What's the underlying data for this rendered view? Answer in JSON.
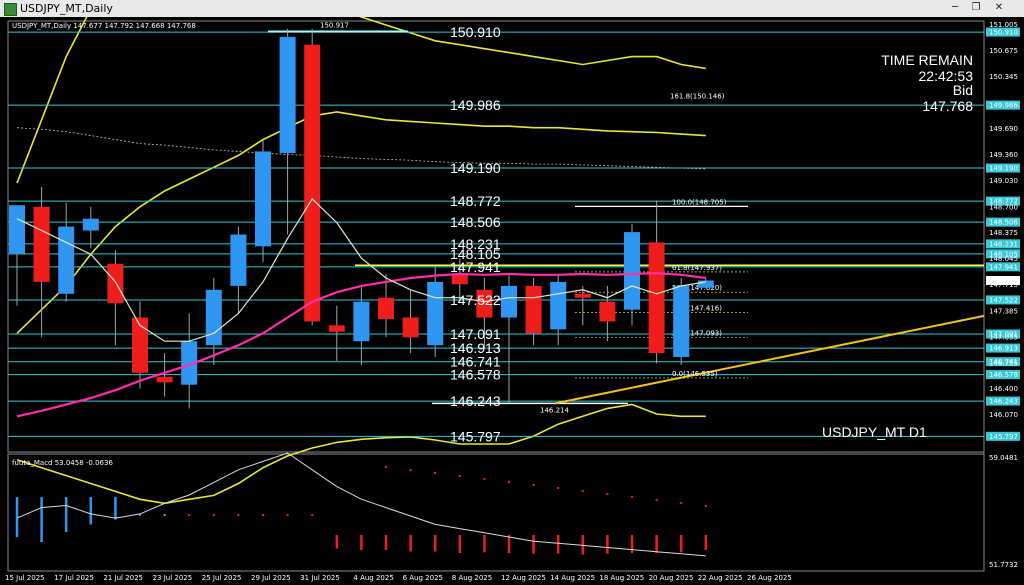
{
  "window": {
    "title": "USDJPY_MT,Daily",
    "min_glyph": "─",
    "max_glyph": "❐",
    "close_glyph": "✕"
  },
  "ohlc_header": "USDJPY_MT,Daily  147.677 147.792 147.668 147.768",
  "info_panel": {
    "label": "TIME REMAIN",
    "time": "22:42:53",
    "bid_label": "Bid",
    "bid": "147.768"
  },
  "watermark": "USDJPY_MT D1",
  "indicator_label": "fuuta_Macd 53.0458  -0.0636",
  "price_axis": [
    "151.005",
    "150.910",
    "150.675",
    "150.345",
    "149.986",
    "149.690",
    "149.360",
    "149.190",
    "149.030",
    "148.772",
    "148.700",
    "148.506",
    "148.375",
    "148.231",
    "148.105",
    "148.045",
    "147.941",
    "147.768",
    "147.715",
    "147.522",
    "147.385",
    "147.091",
    "147.055",
    "146.913",
    "146.741",
    "146.725",
    "146.578",
    "146.400",
    "146.243",
    "146.070",
    "145.797"
  ],
  "sub_axis": [
    "59.0481",
    "51.7732"
  ],
  "level_labels": [
    "150.910",
    "149.986",
    "149.190",
    "148.772",
    "148.506",
    "148.231",
    "148.105",
    "147.941",
    "147.522",
    "147.091",
    "146.913",
    "146.741",
    "146.578",
    "146.243",
    "145.797"
  ],
  "swing_high": "150.917",
  "swing_low": "146.214",
  "fib_labels": [
    "161.8(150.146)",
    "100.0(148.705)",
    "61.8(147.937)",
    "50.0(147.620)",
    "38.2(147.416)",
    "23.6(147.093)",
    "0.0(146.535)"
  ],
  "dates": [
    "15 Jul 2025",
    "17 Jul 2025",
    "21 Jul 2025",
    "23 Jul 2025",
    "25 Jul 2025",
    "29 Jul 2025",
    "31 Jul 2025",
    "4 Aug 2025",
    "6 Aug 2025",
    "8 Aug 2025",
    "12 Aug 2025",
    "14 Aug 2025",
    "18 Aug 2025",
    "20 Aug 2025",
    "22 Aug 2025",
    "26 Aug 2025"
  ],
  "colors": {
    "bull": "#2f96f2",
    "bear": "#f01d1d",
    "level": "#37c8d8",
    "fib": "#ffff33",
    "band": "#e8e832",
    "ma_fast": "#ffffff",
    "ma_mid": "#ff2eaa"
  },
  "chart_data": {
    "type": "candlestick",
    "symbol": "USDJPY_MT",
    "timeframe": "Daily",
    "ylim": [
      145.7,
      151.05
    ],
    "candles": [
      {
        "o": 148.1,
        "h": 148.7,
        "l": 147.45,
        "c": 148.72
      },
      {
        "o": 148.7,
        "h": 148.95,
        "l": 147.05,
        "c": 147.75
      },
      {
        "o": 147.6,
        "h": 148.75,
        "l": 147.5,
        "c": 148.45
      },
      {
        "o": 148.4,
        "h": 148.7,
        "l": 148.18,
        "c": 148.55
      },
      {
        "o": 147.98,
        "h": 148.15,
        "l": 146.95,
        "c": 147.48
      },
      {
        "o": 147.3,
        "h": 147.5,
        "l": 146.4,
        "c": 146.6
      },
      {
        "o": 146.55,
        "h": 146.85,
        "l": 146.3,
        "c": 146.48
      },
      {
        "o": 146.45,
        "h": 147.35,
        "l": 146.15,
        "c": 147.0
      },
      {
        "o": 146.95,
        "h": 147.8,
        "l": 146.7,
        "c": 147.65
      },
      {
        "o": 147.7,
        "h": 148.45,
        "l": 147.35,
        "c": 148.35
      },
      {
        "o": 148.2,
        "h": 149.55,
        "l": 148.0,
        "c": 149.4
      },
      {
        "o": 149.38,
        "h": 150.95,
        "l": 148.35,
        "c": 150.85
      },
      {
        "o": 150.75,
        "h": 150.95,
        "l": 147.2,
        "c": 147.25
      },
      {
        "o": 147.2,
        "h": 147.45,
        "l": 146.75,
        "c": 147.12
      },
      {
        "o": 147.0,
        "h": 147.7,
        "l": 146.7,
        "c": 147.5
      },
      {
        "o": 147.55,
        "h": 147.85,
        "l": 147.05,
        "c": 147.28
      },
      {
        "o": 147.3,
        "h": 147.65,
        "l": 146.85,
        "c": 147.05
      },
      {
        "o": 146.95,
        "h": 147.95,
        "l": 146.8,
        "c": 147.75
      },
      {
        "o": 147.85,
        "h": 148.05,
        "l": 147.5,
        "c": 147.72
      },
      {
        "o": 147.65,
        "h": 147.8,
        "l": 146.9,
        "c": 147.3
      },
      {
        "o": 147.3,
        "h": 147.85,
        "l": 146.214,
        "c": 147.7
      },
      {
        "o": 147.7,
        "h": 147.8,
        "l": 146.95,
        "c": 147.1
      },
      {
        "o": 147.15,
        "h": 147.85,
        "l": 146.95,
        "c": 147.75
      },
      {
        "o": 147.6,
        "h": 147.7,
        "l": 147.2,
        "c": 147.55
      },
      {
        "o": 147.5,
        "h": 147.7,
        "l": 147.0,
        "c": 147.25
      },
      {
        "o": 147.4,
        "h": 148.48,
        "l": 147.2,
        "c": 148.38
      },
      {
        "o": 148.25,
        "h": 148.78,
        "l": 146.72,
        "c": 146.85
      },
      {
        "o": 146.8,
        "h": 147.8,
        "l": 146.7,
        "c": 147.7
      },
      {
        "o": 147.677,
        "h": 147.792,
        "l": 147.668,
        "c": 147.768
      }
    ],
    "levels": [
      150.91,
      149.986,
      149.19,
      148.772,
      148.506,
      148.231,
      148.105,
      147.941,
      147.522,
      147.091,
      146.913,
      146.741,
      146.578,
      146.243,
      145.797
    ],
    "fibonacci": {
      "high": 148.705,
      "low": 146.535,
      "ratios": [
        161.8,
        100.0,
        61.8,
        50.0,
        38.2,
        23.6,
        0.0
      ]
    },
    "ma_fast": [
      148.55,
      148.4,
      148.25,
      148.1,
      147.75,
      147.2,
      147.0,
      147.0,
      147.1,
      147.35,
      147.75,
      148.3,
      148.8,
      148.5,
      148.05,
      147.8,
      147.65,
      147.55,
      147.55,
      147.5,
      147.55,
      147.55,
      147.6,
      147.65,
      147.55,
      147.7,
      147.6,
      147.7,
      147.75
    ],
    "ma_pink": [
      146.05,
      146.12,
      146.2,
      146.28,
      146.38,
      146.5,
      146.6,
      146.7,
      146.82,
      146.95,
      147.1,
      147.3,
      147.5,
      147.62,
      147.7,
      147.75,
      147.8,
      147.83,
      147.85,
      147.84,
      147.85,
      147.84,
      147.84,
      147.85,
      147.84,
      147.85,
      147.86,
      147.84,
      147.8
    ],
    "band_upper": [
      149.0,
      149.8,
      150.6,
      151.2,
      151.5,
      151.7,
      151.8,
      151.8,
      151.7,
      151.6,
      151.5,
      151.4,
      151.3,
      151.2,
      151.1,
      151.0,
      150.9,
      150.8,
      150.75,
      150.7,
      150.65,
      150.6,
      150.55,
      150.5,
      150.55,
      150.6,
      150.6,
      150.5,
      150.45
    ],
    "band_mid": [
      147.1,
      147.4,
      147.7,
      148.1,
      148.45,
      148.7,
      148.9,
      149.05,
      149.2,
      149.35,
      149.55,
      149.7,
      149.85,
      149.9,
      149.85,
      149.8,
      149.78,
      149.76,
      149.74,
      149.72,
      149.72,
      149.7,
      149.7,
      149.68,
      149.66,
      149.65,
      149.64,
      149.62,
      149.6
    ],
    "band_lower": [
      145.5,
      145.4,
      145.3,
      145.2,
      145.1,
      145.0,
      144.95,
      145.0,
      145.05,
      145.2,
      145.4,
      145.55,
      145.65,
      145.72,
      145.76,
      145.78,
      145.79,
      145.75,
      145.7,
      145.7,
      145.7,
      145.8,
      145.95,
      146.05,
      146.15,
      146.2,
      146.08,
      146.05,
      146.05
    ],
    "dotted_line": [
      149.7,
      149.68,
      149.65,
      149.6,
      149.55,
      149.5,
      149.48,
      149.45,
      149.42,
      149.4,
      149.38,
      149.36,
      149.35,
      149.33,
      149.31,
      149.3,
      149.29,
      149.27,
      149.26,
      149.25,
      149.25,
      149.24,
      149.24,
      149.23,
      149.22,
      149.21,
      149.2,
      149.19,
      149.18
    ],
    "trendline": {
      "from": [
        20,
        146.214
      ],
      "to": [
        28,
        146.9
      ]
    },
    "macd": {
      "name": "fuuta_Macd",
      "value": 53.0458,
      "signal": -0.0636,
      "range": [
        51.7732,
        59.0481
      ],
      "hist": [
        0.8,
        0.9,
        0.7,
        0.55,
        0.45,
        0.25,
        0.05,
        -0.05,
        -0.1,
        -0.12,
        -0.15,
        -0.2,
        -0.3,
        -0.45,
        -0.5,
        -0.5,
        -0.55,
        -0.55,
        -0.6,
        -0.58,
        -0.6,
        -0.62,
        -0.62,
        -0.65,
        -0.62,
        -0.6,
        -0.6,
        -0.58,
        -0.5
      ]
    }
  }
}
